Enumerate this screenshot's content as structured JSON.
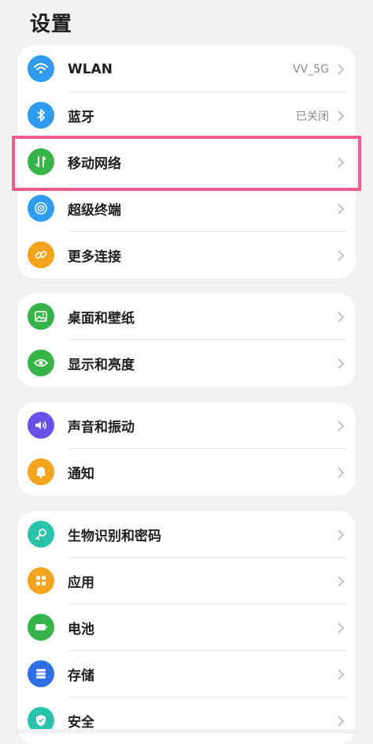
{
  "page": {
    "title": "设置"
  },
  "colors": {
    "wlan": "#2e9bf0",
    "bluetooth": "#2e9bf0",
    "mobile_network": "#36b44a",
    "super_terminal": "#2e9bf0",
    "more_connections": "#f4a31c",
    "wallpaper": "#36b44a",
    "display": "#36b44a",
    "sound": "#6a4fe8",
    "notifications": "#f4a31c",
    "biometrics": "#29c2ab",
    "apps": "#f4a31c",
    "battery": "#36b44a",
    "storage": "#2e6fe6",
    "security": "#29c2ab",
    "highlight": "#f25b8d"
  },
  "groups": [
    {
      "items": [
        {
          "label": "WLAN",
          "value": "VV_5G",
          "icon": "wifi-icon"
        },
        {
          "label": "蓝牙",
          "value": "已关闭",
          "icon": "bluetooth-icon"
        },
        {
          "label": "移动网络",
          "value": "",
          "icon": "mobile-data-icon"
        },
        {
          "label": "超级终端",
          "value": "",
          "icon": "super-device-icon"
        },
        {
          "label": "更多连接",
          "value": "",
          "icon": "link-icon"
        }
      ]
    },
    {
      "items": [
        {
          "label": "桌面和壁纸",
          "value": "",
          "icon": "image-icon"
        },
        {
          "label": "显示和亮度",
          "value": "",
          "icon": "eye-icon"
        }
      ]
    },
    {
      "items": [
        {
          "label": "声音和振动",
          "value": "",
          "icon": "speaker-icon"
        },
        {
          "label": "通知",
          "value": "",
          "icon": "bell-icon"
        }
      ]
    },
    {
      "items": [
        {
          "label": "生物识别和密码",
          "value": "",
          "icon": "key-icon"
        },
        {
          "label": "应用",
          "value": "",
          "icon": "apps-grid-icon"
        },
        {
          "label": "电池",
          "value": "",
          "icon": "battery-icon"
        },
        {
          "label": "存储",
          "value": "",
          "icon": "storage-icon"
        },
        {
          "label": "安全",
          "value": "",
          "icon": "shield-icon"
        }
      ]
    }
  ]
}
